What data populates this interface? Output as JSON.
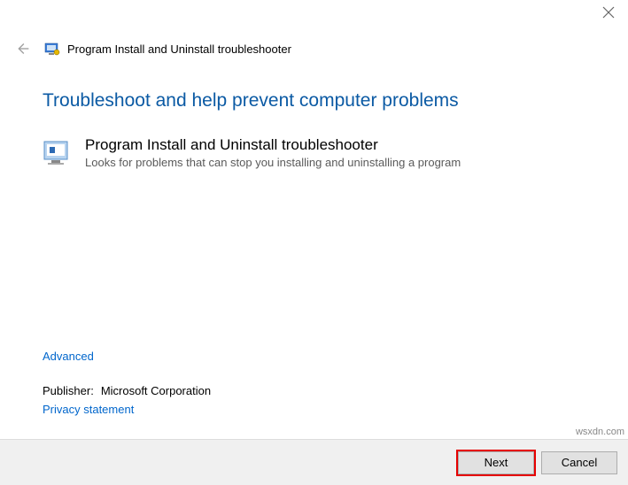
{
  "window": {
    "title": "Program Install and Uninstall troubleshooter"
  },
  "main": {
    "heading": "Troubleshoot and help prevent computer problems",
    "item": {
      "title": "Program Install and Uninstall troubleshooter",
      "desc": "Looks for problems that can stop you installing and uninstalling a program"
    }
  },
  "links": {
    "advanced": "Advanced",
    "publisher_label": "Publisher:",
    "publisher_value": "Microsoft Corporation",
    "privacy": "Privacy statement"
  },
  "footer": {
    "next": "Next",
    "cancel": "Cancel"
  },
  "watermark": "wsxdn.com"
}
